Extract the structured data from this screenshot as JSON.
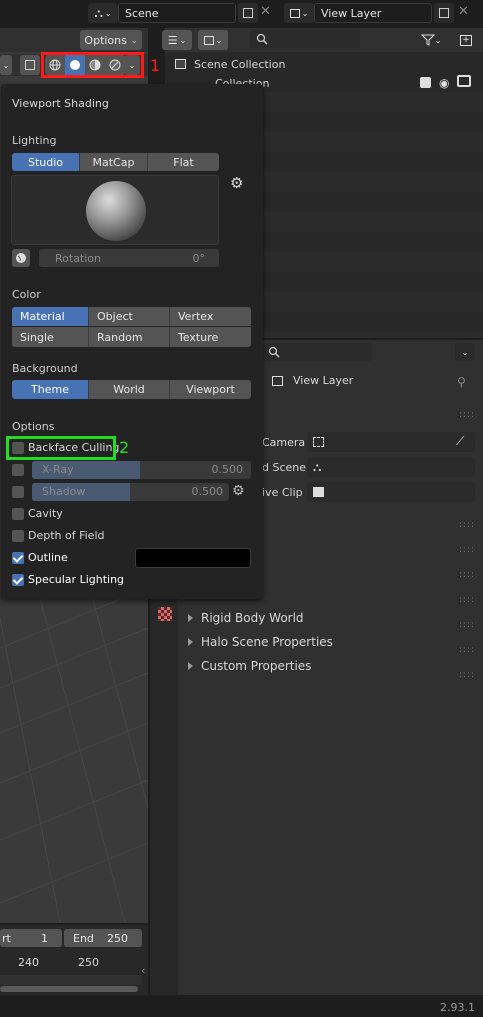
{
  "header": {
    "scene_label": "Scene",
    "view_layer_label": "View Layer",
    "options_label": "Options"
  },
  "outliner": {
    "search_placeholder": "",
    "scene_collection": "Scene Collection",
    "collection": "Collection"
  },
  "viewport_shading": {
    "title": "Viewport Shading",
    "lighting_label": "Lighting",
    "lighting_options": [
      "Studio",
      "MatCap",
      "Flat"
    ],
    "lighting_selected": "Studio",
    "rotation_label": "Rotation",
    "rotation_value": "0°",
    "color_label": "Color",
    "color_options": [
      "Material",
      "Object",
      "Vertex",
      "Single",
      "Random",
      "Texture"
    ],
    "color_selected": "Material",
    "background_label": "Background",
    "background_options": [
      "Theme",
      "World",
      "Viewport"
    ],
    "background_selected": "Theme",
    "options_label": "Options",
    "backface_culling": "Backface Culling",
    "xray_label": "X-Ray",
    "xray_value": "0.500",
    "shadow_label": "Shadow",
    "shadow_value": "0.500",
    "cavity": "Cavity",
    "depth_of_field": "Depth of Field",
    "outline": "Outline",
    "specular_lighting": "Specular Lighting",
    "outline_color": "#000000"
  },
  "annotations": {
    "marker_1": "1",
    "marker_2": "2",
    "marker_1_color": "#ff1a1a",
    "marker_2_color": "#22dd22"
  },
  "properties": {
    "view_layer": "View Layer",
    "camera_label": "Camera",
    "background_scene_label": "d Scene",
    "active_clip_label": "ive Clip",
    "panels": [
      "Rigid Body World",
      "Halo Scene Properties",
      "Custom Properties"
    ]
  },
  "timeline": {
    "start_label": "rt",
    "start_value": "1",
    "end_label": "End",
    "end_value": "250",
    "tick_240": "240",
    "tick_250": "250"
  },
  "status_bar": {
    "version": "2.93.1"
  },
  "colors": {
    "accent": "#4772b3",
    "panel": "#303030",
    "popup": "#232323",
    "button": "#545454"
  }
}
